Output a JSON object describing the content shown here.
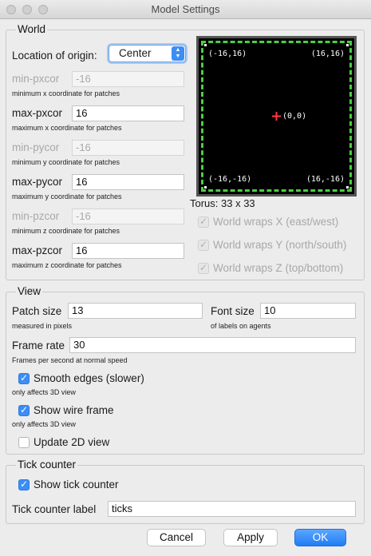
{
  "window": {
    "title": "Model Settings"
  },
  "world": {
    "title": "World",
    "origin_label": "Location of origin:",
    "origin_value": "Center",
    "fields": [
      {
        "label": "min-pxcor",
        "value": "-16",
        "hint": "minimum x coordinate for patches",
        "enabled": false
      },
      {
        "label": "max-pxcor",
        "value": "16",
        "hint": "maximum x coordinate for patches",
        "enabled": true
      },
      {
        "label": "min-pycor",
        "value": "-16",
        "hint": "minimum y coordinate for patches",
        "enabled": false
      },
      {
        "label": "max-pycor",
        "value": "16",
        "hint": "maximum y coordinate for patches",
        "enabled": true
      },
      {
        "label": "min-pzcor",
        "value": "-16",
        "hint": "minimum z coordinate for patches",
        "enabled": false
      },
      {
        "label": "max-pzcor",
        "value": "16",
        "hint": "maximum z coordinate for patches",
        "enabled": true
      }
    ],
    "preview": {
      "top_left": "(-16,16)",
      "top_right": "(16,16)",
      "center": "(0,0)",
      "bottom_left": "(-16,-16)",
      "bottom_right": "(16,-16)"
    },
    "torus_label": "Torus: 33 x 33",
    "wraps": [
      {
        "label": "World wraps X (east/west)",
        "checked": true
      },
      {
        "label": "World wraps Y (north/south)",
        "checked": true
      },
      {
        "label": "World wraps Z (top/bottom)",
        "checked": true
      }
    ]
  },
  "view": {
    "title": "View",
    "patch_size_label": "Patch size",
    "patch_size_value": "13",
    "patch_size_hint": "measured in pixels",
    "font_size_label": "Font size",
    "font_size_value": "10",
    "font_size_hint": "of labels on agents",
    "frame_rate_label": "Frame rate",
    "frame_rate_value": "30",
    "frame_rate_hint": "Frames per second at normal speed",
    "smooth_edges_label": "Smooth edges (slower)",
    "smooth_edges_hint": "only affects 3D view",
    "wire_frame_label": "Show wire frame",
    "wire_frame_hint": "only affects 3D view",
    "update_2d_label": "Update 2D view"
  },
  "tick": {
    "title": "Tick counter",
    "show_label": "Show tick counter",
    "counter_label_label": "Tick counter label",
    "counter_label_value": "ticks"
  },
  "buttons": {
    "cancel": "Cancel",
    "apply": "Apply",
    "ok": "OK"
  },
  "colors": {
    "accent": "#3d8df5",
    "preview_border": "#49d13f",
    "origin_marker": "#ff3b3b"
  }
}
